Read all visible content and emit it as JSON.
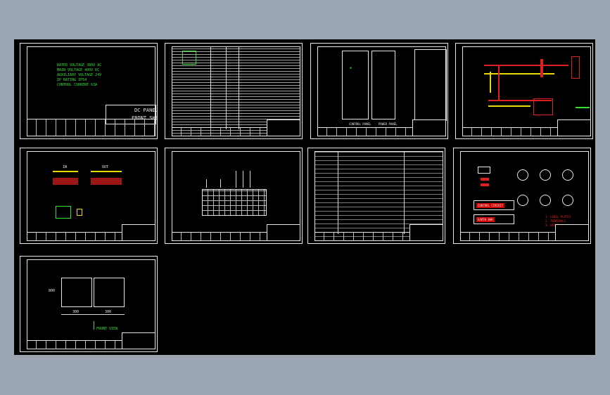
{
  "sheets": {
    "s1": {
      "specs": [
        "RATED VOLTAGE 380V AC",
        "MAIN VOLTAGE 400V DC",
        "AUXILIARY VOLTAGE 24V",
        "IP RATING IP54",
        "CONTROL CURRENT 63A"
      ],
      "title_line1": "DC PANEL",
      "title_line2": "FRONT SHEET"
    },
    "s3": {
      "labels": [
        "CONTROL PANEL",
        "POWER PANEL",
        "FRONT VIEW"
      ]
    },
    "s9": {
      "dim_left": "300",
      "dim_right": "300",
      "height_dim": "800",
      "view_label": "FRONT VIEW"
    },
    "s8": {
      "box1": "CONTROL CIRCUIT",
      "box2": "EARTH BAR",
      "notes": [
        "1. LABEL PLATES",
        "2. TERMINALS",
        "3. WIRES"
      ]
    },
    "s5": {
      "label_a": "IN",
      "label_b": "OUT"
    }
  },
  "colors": {
    "canvas": "#000000",
    "frame": "#e8e8e8",
    "annotation": "#2fe02f",
    "busbar": "#e02020",
    "cable": "#e6d800"
  }
}
